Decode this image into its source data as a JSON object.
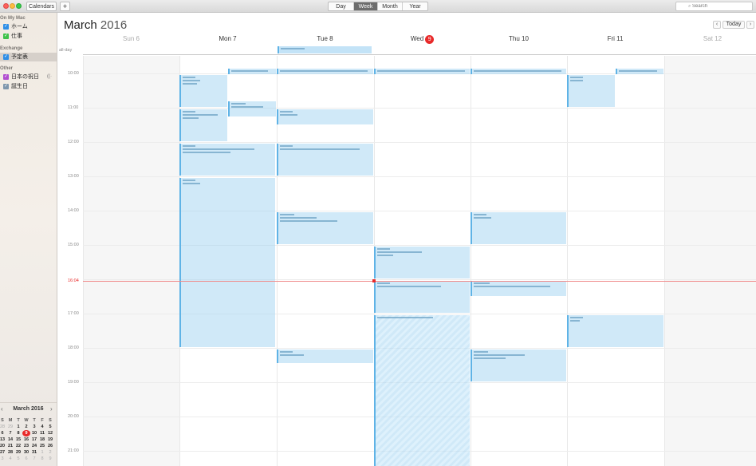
{
  "toolbar": {
    "calendars_label": "Calendars",
    "add_label": "+",
    "views": [
      "Day",
      "Week",
      "Month",
      "Year"
    ],
    "active_view": "Week",
    "search_placeholder": "Search"
  },
  "sidebar": {
    "sections": [
      {
        "header": "On My Mac",
        "items": [
          {
            "label": "ホーム",
            "color": "#2e8ee6",
            "checked": true
          },
          {
            "label": "仕事",
            "color": "#3ec24a",
            "checked": true
          }
        ]
      },
      {
        "header": "Exchange",
        "items": [
          {
            "label": "予定表",
            "color": "#2e8ee6",
            "checked": true,
            "selected": true
          }
        ]
      },
      {
        "header": "Other",
        "items": [
          {
            "label": "日本の祝日",
            "color": "#b14fd0",
            "checked": true,
            "extra": "((·"
          },
          {
            "label": "誕生日",
            "color": "#7e97ad",
            "checked": true
          }
        ]
      }
    ]
  },
  "mini_calendar": {
    "title": "March 2016",
    "prev": "‹",
    "next": "›",
    "weekdays": [
      "S",
      "M",
      "T",
      "W",
      "T",
      "F",
      "S"
    ],
    "weeks": [
      [
        {
          "d": "28",
          "dim": true
        },
        {
          "d": "29",
          "dim": true
        },
        {
          "d": "1"
        },
        {
          "d": "2"
        },
        {
          "d": "3"
        },
        {
          "d": "4"
        },
        {
          "d": "5"
        }
      ],
      [
        {
          "d": "6"
        },
        {
          "d": "7"
        },
        {
          "d": "8"
        },
        {
          "d": "9",
          "today": true
        },
        {
          "d": "10"
        },
        {
          "d": "11"
        },
        {
          "d": "12"
        }
      ],
      [
        {
          "d": "13"
        },
        {
          "d": "14"
        },
        {
          "d": "15"
        },
        {
          "d": "16"
        },
        {
          "d": "17"
        },
        {
          "d": "18"
        },
        {
          "d": "19"
        }
      ],
      [
        {
          "d": "20"
        },
        {
          "d": "21"
        },
        {
          "d": "22"
        },
        {
          "d": "23"
        },
        {
          "d": "24"
        },
        {
          "d": "25"
        },
        {
          "d": "26"
        }
      ],
      [
        {
          "d": "27"
        },
        {
          "d": "28"
        },
        {
          "d": "29"
        },
        {
          "d": "30"
        },
        {
          "d": "31"
        },
        {
          "d": "1",
          "dim": true
        },
        {
          "d": "2",
          "dim": true
        }
      ],
      [
        {
          "d": "3",
          "dim": true
        },
        {
          "d": "4",
          "dim": true
        },
        {
          "d": "5",
          "dim": true
        },
        {
          "d": "6",
          "dim": true
        },
        {
          "d": "7",
          "dim": true
        },
        {
          "d": "8",
          "dim": true
        },
        {
          "d": "9",
          "dim": true
        }
      ]
    ]
  },
  "header": {
    "month": "March",
    "year": "2016",
    "today_label": "Today",
    "prev": "‹",
    "next": "›"
  },
  "days": [
    {
      "label": "Sun 6",
      "weekend": true
    },
    {
      "label": "Mon 7"
    },
    {
      "label": "Tue 8"
    },
    {
      "label": "Wed",
      "badge": "9"
    },
    {
      "label": "Thu 10"
    },
    {
      "label": "Fri 11"
    },
    {
      "label": "Sat 12",
      "weekend": true
    }
  ],
  "allday_label": "all-day",
  "time_labels": [
    "10:00",
    "11:00",
    "12:00",
    "13:00",
    "14:00",
    "15:00",
    "16:00",
    "17:00",
    "18:00",
    "19:00",
    "20:00",
    "21:00"
  ],
  "current_time": "16:04",
  "colors": {
    "event_fill": "#aad7f3",
    "event_border": "#5fb3e6",
    "today_red": "#e82a2a"
  }
}
